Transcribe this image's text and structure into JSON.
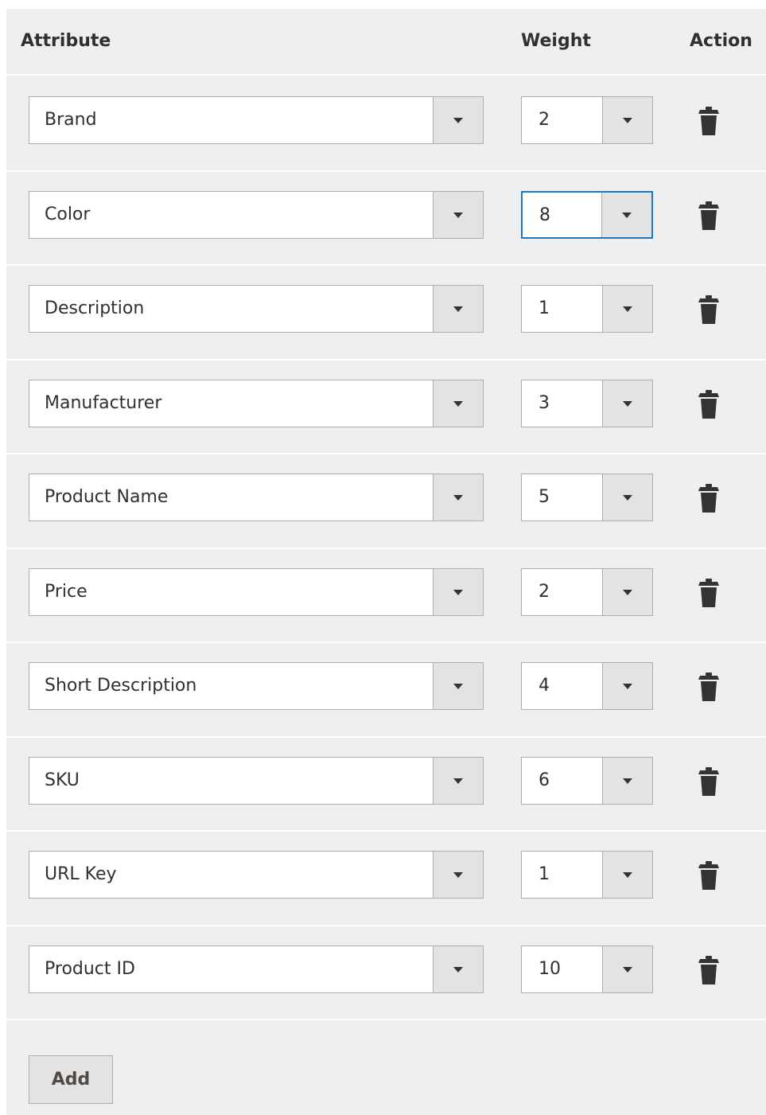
{
  "table": {
    "headers": {
      "attribute": "Attribute",
      "weight": "Weight",
      "action": "Action"
    },
    "rows": [
      {
        "attribute": "Brand",
        "weight": "2"
      },
      {
        "attribute": "Color",
        "weight": "8",
        "focused": true
      },
      {
        "attribute": "Description",
        "weight": "1"
      },
      {
        "attribute": "Manufacturer",
        "weight": "3"
      },
      {
        "attribute": "Product Name",
        "weight": "5"
      },
      {
        "attribute": "Price",
        "weight": "2"
      },
      {
        "attribute": "Short Description",
        "weight": "4"
      },
      {
        "attribute": "SKU",
        "weight": "6"
      },
      {
        "attribute": "URL Key",
        "weight": "1"
      },
      {
        "attribute": "Product ID",
        "weight": "10"
      }
    ],
    "row_action_icon": "trash-icon",
    "dropdown_icon": "caret-down-icon"
  },
  "footer": {
    "add_label": "Add"
  },
  "colors": {
    "panel_bg": "#efefef",
    "focus_border": "#1979c3",
    "input_border": "#adadad",
    "arrow_bg": "#e3e3e3",
    "icon": "#333333"
  }
}
